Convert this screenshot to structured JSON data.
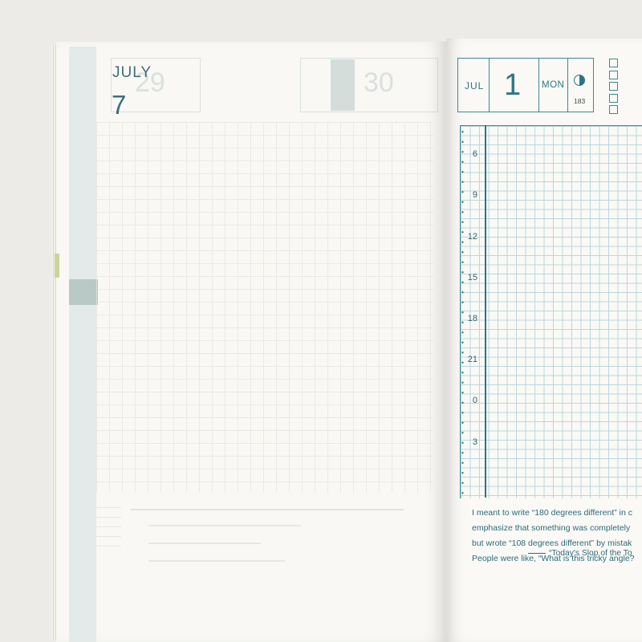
{
  "left_page": {
    "month": "JULY",
    "month_number": "7"
  },
  "right_page": {
    "month_abbr": "JUL",
    "day": "1",
    "weekday": "MON",
    "day_of_year": "183",
    "hours": [
      "6",
      "9",
      "12",
      "15",
      "18",
      "21",
      "0",
      "3"
    ],
    "quote_lines": [
      "I meant to write “180 degrees different” in c",
      "emphasize that something was completely",
      "but wrote “108 degrees different” by mistak",
      "People were like, “What is this tricky angle?"
    ],
    "quote_source": "“Today's Slop of the To"
  },
  "colors": {
    "accent": "#2d7583",
    "grid": "#b9d7db",
    "paper": "#faf9f6"
  }
}
